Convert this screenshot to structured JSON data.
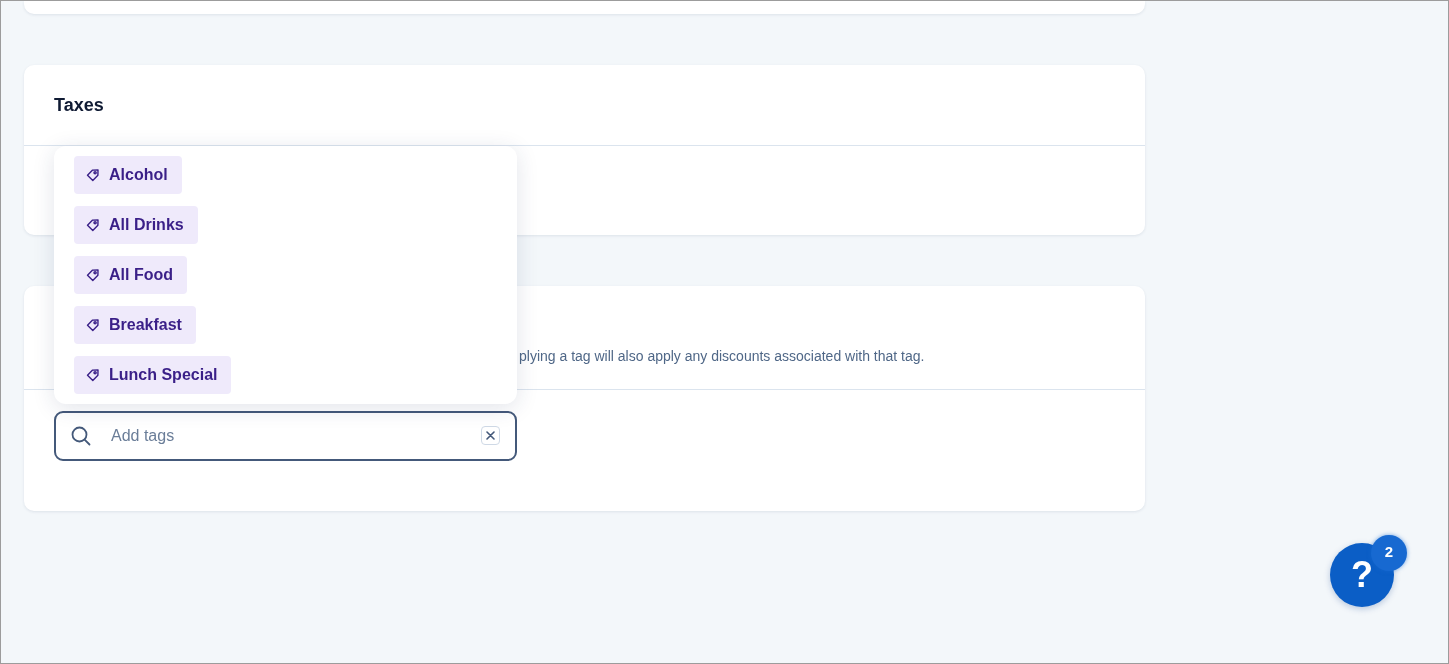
{
  "taxes_card": {
    "title": "Taxes"
  },
  "tags_card": {
    "description": "plying a tag will also apply any discounts associated with that tag.",
    "tag_field": {
      "placeholder": "Add tags",
      "options": [
        {
          "label": "Alcohol"
        },
        {
          "label": "All Drinks"
        },
        {
          "label": "All Food"
        },
        {
          "label": "Breakfast"
        },
        {
          "label": "Lunch Special"
        }
      ]
    }
  },
  "help_button": {
    "label": "?",
    "badge": "2"
  }
}
